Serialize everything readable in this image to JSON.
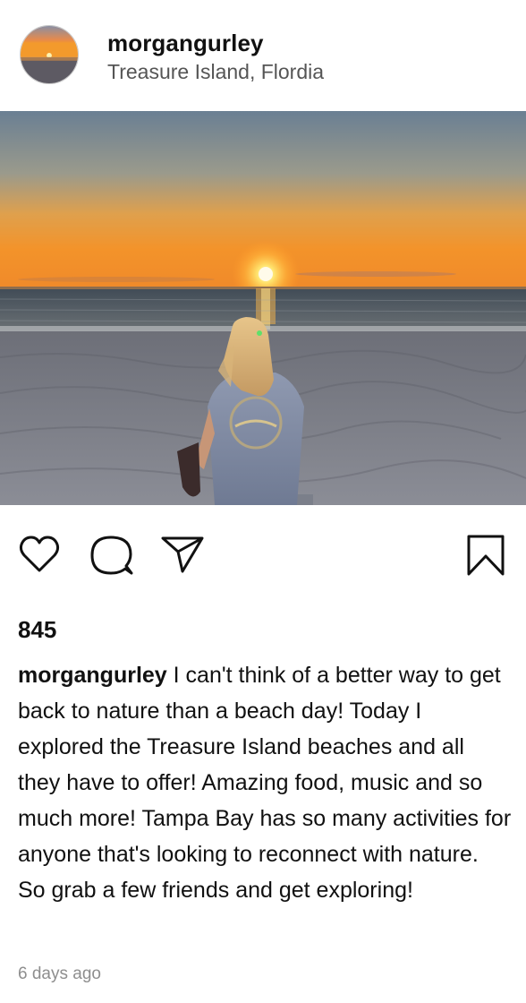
{
  "post": {
    "username": "morgangurley",
    "location": "Treasure Island, Flordia",
    "likes": "845",
    "caption_user": "morgangurley",
    "caption_text": "I can't think of a better way to get back to nature than a beach day! Today I explored the Treasure Island beaches and all they have to offer! Amazing food, music and so much more! Tampa Bay has so many activities for anyone that's looking to reconnect with nature. So grab a few friends and get exploring!",
    "timestamp": "6 days ago"
  },
  "icons": {
    "like": "heart-icon",
    "comment": "comment-icon",
    "share": "paper-plane-icon",
    "save": "bookmark-icon"
  },
  "colors": {
    "text": "#111111",
    "secondary_text": "#555555",
    "timestamp": "#8e8e8e"
  }
}
